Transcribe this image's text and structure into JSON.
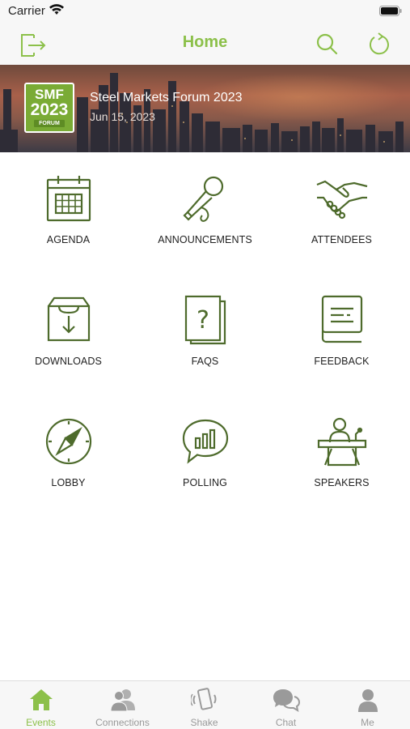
{
  "status_bar": {
    "carrier": "Carrier"
  },
  "nav": {
    "title": "Home",
    "left_icon": "logout-icon",
    "right_icons": [
      "search-icon",
      "refresh-icon"
    ]
  },
  "event": {
    "logo_lines": [
      "SMF",
      "2023",
      "FORUM"
    ],
    "name": "Steel Markets Forum 2023",
    "date": "Jun 15, 2023"
  },
  "tiles": [
    {
      "label": "AGENDA",
      "icon": "calendar-icon"
    },
    {
      "label": "ANNOUNCEMENTS",
      "icon": "microphone-icon"
    },
    {
      "label": "ATTENDEES",
      "icon": "handshake-icon"
    },
    {
      "label": "DOWNLOADS",
      "icon": "download-box-icon"
    },
    {
      "label": "FAQS",
      "icon": "question-document-icon"
    },
    {
      "label": "FEEDBACK",
      "icon": "feedback-book-icon"
    },
    {
      "label": "LOBBY",
      "icon": "compass-icon"
    },
    {
      "label": "POLLING",
      "icon": "poll-chat-icon"
    },
    {
      "label": "SPEAKERS",
      "icon": "podium-speaker-icon"
    }
  ],
  "tabs": [
    {
      "label": "Events",
      "icon": "home-icon",
      "active": true
    },
    {
      "label": "Connections",
      "icon": "people-icon",
      "active": false
    },
    {
      "label": "Shake",
      "icon": "phone-shake-icon",
      "active": false
    },
    {
      "label": "Chat",
      "icon": "chat-bubbles-icon",
      "active": false
    },
    {
      "label": "Me",
      "icon": "person-icon",
      "active": false
    }
  ],
  "colors": {
    "accent": "#8cc04a",
    "icon_dark_green": "#4e6b2c",
    "logo_green": "#7aab35",
    "inactive": "#9a9a9a"
  }
}
